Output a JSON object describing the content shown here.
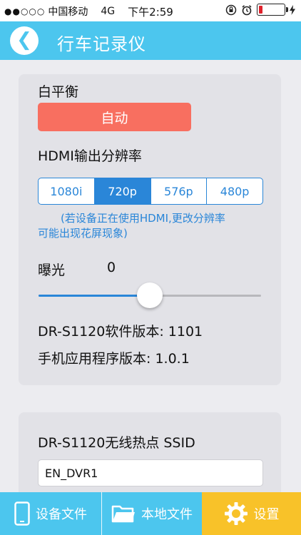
{
  "status_bar": {
    "signal": "●●○○○",
    "carrier": "中国移动",
    "network": "4G",
    "time": "下午2:59",
    "battery_level": 0.15,
    "battery_color": "#e0212b"
  },
  "header": {
    "back_icon": "chevron-left-icon",
    "title": "行车记录仪"
  },
  "settings": {
    "white_balance_label": "白平衡",
    "white_balance_value": "自动",
    "hdmi_label": "HDMI输出分辨率",
    "hdmi_options": [
      "1080i",
      "720p",
      "576p",
      "480p"
    ],
    "hdmi_selected": "720p",
    "hdmi_hint_line1": "(若设备正在使用HDMI,更改分辨率",
    "hdmi_hint_line2": "可能出现花屏现象)",
    "exposure_label": "曝光",
    "exposure_value": "0",
    "exposure_slider_fraction": 0.5,
    "firmware_version_text": "DR-S1120软件版本: 1101",
    "app_version_text": "手机应用程序版本: 1.0.1"
  },
  "wifi": {
    "ssid_label": "DR-S1120无线热点 SSID",
    "ssid_value": "EN_DVR1"
  },
  "tabbar": {
    "device_files": "设备文件",
    "local_files": "本地文件",
    "settings": "设置",
    "active_tab": "settings"
  },
  "colors": {
    "accent": "#4cc6ee",
    "selected_blue": "#2a86d8",
    "auto_button": "#f86f60",
    "settings_tab": "#f8c229"
  }
}
